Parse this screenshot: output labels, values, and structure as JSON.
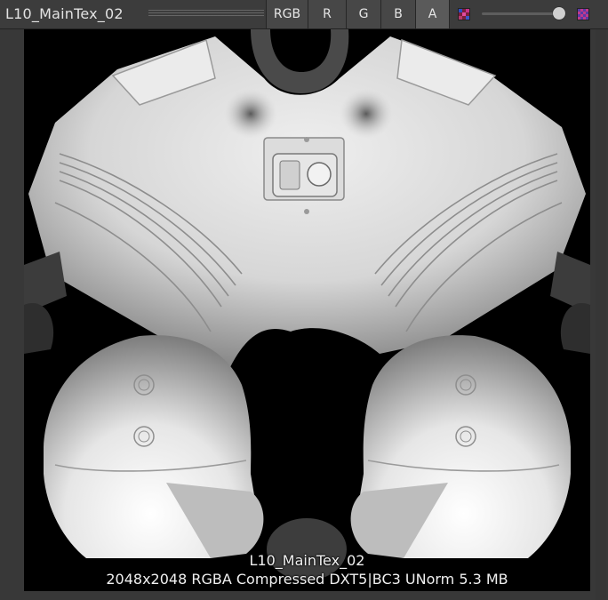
{
  "toolbar": {
    "texture_name": "L10_MainTex_02",
    "channels": [
      {
        "label": "RGB",
        "active": false
      },
      {
        "label": "R",
        "active": false
      },
      {
        "label": "G",
        "active": false
      },
      {
        "label": "B",
        "active": false
      },
      {
        "label": "A",
        "active": true
      }
    ],
    "mip_level": 1.0,
    "icons": [
      "color-mode-icon",
      "checker-icon"
    ]
  },
  "caption": {
    "name": "L10_MainTex_02",
    "info": "2048x2048  RGBA Compressed DXT5|BC3 UNorm   5.3 MB"
  },
  "colors": {
    "toolbar": "#3c3c3c",
    "canvas": "#000000",
    "active_channel": "#5a5a5a"
  }
}
